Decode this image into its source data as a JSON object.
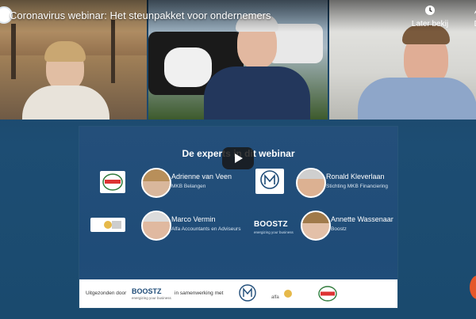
{
  "video": {
    "title": "Coronavirus webinar: Het steunpakket voor ondernemers",
    "controls": {
      "watch_later_label": "Later bekij",
      "share_label": "De"
    }
  },
  "slide": {
    "heading": "De experts in dit webinar",
    "experts": [
      {
        "name": "Adrienne van Veen",
        "org": "MKB Belangen"
      },
      {
        "name": "Ronald Kleverlaan",
        "org": "Stichting MKB Financiering"
      },
      {
        "name": "Marco Vermin",
        "org": "Alfa Accountants en Adviseurs"
      },
      {
        "name": "Annette Wassenaar",
        "org": "Boostz"
      }
    ],
    "logos": {
      "mkb_belangen": "MKB BELANGEN",
      "boostz": "BOOSTZ",
      "boostz_tagline": "energizing your business",
      "alfa": "alfa"
    },
    "footer": {
      "broadcast_by": "Uitgezonden door",
      "in_collab": "in samenwerking met"
    }
  },
  "colors": {
    "slide_bg": "#1f4c78",
    "accent_orange": "#e5572a"
  },
  "icons": {
    "watch_later": "clock-icon",
    "share": "share-arrow-icon",
    "play": "play-icon"
  }
}
